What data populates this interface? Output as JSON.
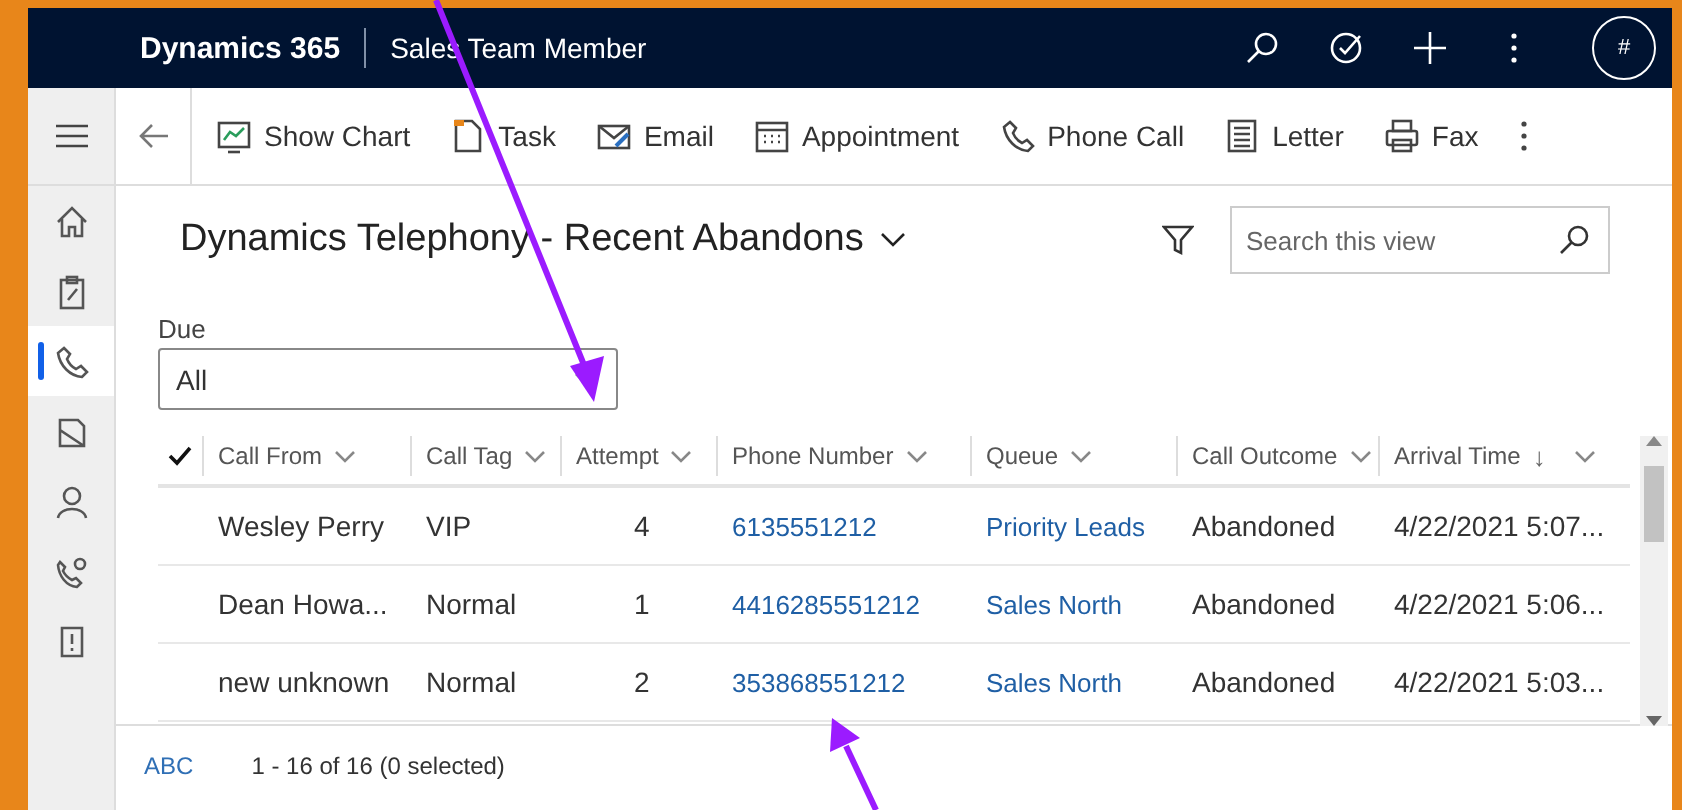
{
  "app": {
    "name": "Dynamics 365",
    "area": "Sales Team Member",
    "avatar": "#"
  },
  "sidebar": {
    "items": [
      {
        "kind": "home",
        "selected": false
      },
      {
        "kind": "clipboard",
        "selected": false
      },
      {
        "kind": "phone",
        "selected": true
      },
      {
        "kind": "book",
        "selected": false
      },
      {
        "kind": "person",
        "selected": false
      },
      {
        "kind": "phone-gear",
        "selected": false
      },
      {
        "kind": "alert",
        "selected": false
      }
    ]
  },
  "toolbar": {
    "items": [
      {
        "kind": "chart",
        "label": "Show Chart"
      },
      {
        "kind": "task",
        "label": "Task"
      },
      {
        "kind": "email",
        "label": "Email"
      },
      {
        "kind": "calendar",
        "label": "Appointment"
      },
      {
        "kind": "phone",
        "label": "Phone Call"
      },
      {
        "kind": "letter",
        "label": "Letter"
      },
      {
        "kind": "fax",
        "label": "Fax"
      }
    ]
  },
  "view": {
    "title": "Dynamics Telephony - Recent Abandons",
    "search": {
      "placeholder": "Search this view"
    },
    "filter": {
      "label": "Due",
      "value": "All"
    }
  },
  "table": {
    "columns": [
      {
        "label": "Call From",
        "kind": "text"
      },
      {
        "label": "Call Tag",
        "kind": "text"
      },
      {
        "label": "Attempt",
        "kind": "number"
      },
      {
        "label": "Phone Number",
        "kind": "link"
      },
      {
        "label": "Queue",
        "kind": "link"
      },
      {
        "label": "Call Outcome",
        "kind": "text"
      },
      {
        "label": "Arrival Time",
        "kind": "text",
        "sort_arrow": "↓"
      }
    ],
    "rows": [
      {
        "cells": [
          "Wesley Perry",
          "VIP",
          "4",
          "6135551212",
          "Priority Leads",
          "Abandoned",
          "4/22/2021 5:07..."
        ]
      },
      {
        "cells": [
          "Dean Howa...",
          "Normal",
          "1",
          "4416285551212",
          "Sales North",
          "Abandoned",
          "4/22/2021 5:06..."
        ]
      },
      {
        "cells": [
          "new unknown",
          "Normal",
          "2",
          "353868551212",
          "Sales North",
          "Abandoned",
          "4/22/2021 5:03..."
        ]
      }
    ]
  },
  "footer": {
    "letter_filter": "ABC",
    "count": "1 - 16 of 16 (0 selected)"
  }
}
